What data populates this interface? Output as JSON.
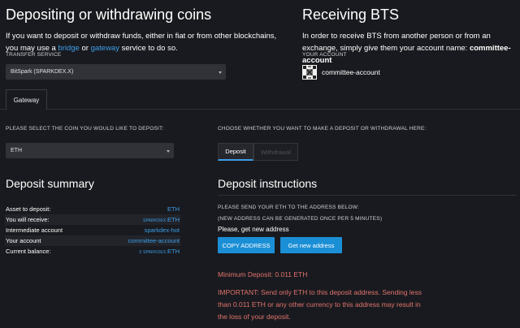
{
  "deposit_section": {
    "title": "Depositing or withdrawing coins",
    "intro_prefix": "If you want to deposit or withdraw funds, either in fiat or from other blockchains, you may use a ",
    "bridge_link": "bridge",
    "intro_or": " or ",
    "gateway_link": "gateway",
    "intro_suffix": " service to do so.",
    "transfer_service_label": "TRANSFER SERVICE",
    "transfer_service_value": "BitSpark (SPARKDEX.X)"
  },
  "receive_section": {
    "title": "Receiving BTS",
    "intro": "In order to receive BTS from another person or from an exchange, simply give them your account name: ",
    "account_name_bold": "committee-account",
    "your_account_label": "YOUR ACCOUNT",
    "account_name": "committee-account"
  },
  "tabs": {
    "gateway": "Gateway"
  },
  "coin_select": {
    "label": "PLEASE SELECT THE COIN YOU WOULD LIKE TO DEPOSIT:",
    "value": "ETH"
  },
  "mode_select": {
    "label": "CHOOSE WHETHER YOU WANT TO MAKE A DEPOSIT OR WITHDRAWAL HERE:",
    "deposit": "Deposit",
    "withdrawal": "Withdrawal"
  },
  "summary": {
    "title": "Deposit summary",
    "rows": [
      {
        "key": "Asset to deposit:",
        "prefix": "",
        "value": "ETH"
      },
      {
        "key": "You will receive:",
        "prefix": "SPARKDEX.",
        "value": "ETH"
      },
      {
        "key": "Intermediate account",
        "prefix": "",
        "value": "sparkdex-hot"
      },
      {
        "key": "Your account",
        "prefix": "",
        "value": "committee-account"
      },
      {
        "key": "Current balance:",
        "prefix": "0 SPARKDEX.",
        "value": "ETH"
      }
    ]
  },
  "instructions": {
    "title": "Deposit instructions",
    "line1": "PLEASE SEND YOUR ETH TO THE ADDRESS BELOW:",
    "line2": "(NEW ADDRESS CAN BE GENERATED ONCE PER 5 MINUTES)",
    "get_new_address_text": "Please, get new address",
    "copy_button": "COPY ADDRESS",
    "new_address_button": "Get new address",
    "min_deposit": "Minimum Deposit: 0.011 ETH",
    "important_line1": "IMPORTANT: Send only ETH to this deposit address. Sending less",
    "important_line2": "than 0.011 ETH or any other currency to this address may result in",
    "important_line3": "the loss of your deposit."
  },
  "colors": {
    "background": "#191a1f",
    "link": "#3d9ee8",
    "button": "#1b8fd6",
    "warning": "#e0746c"
  }
}
